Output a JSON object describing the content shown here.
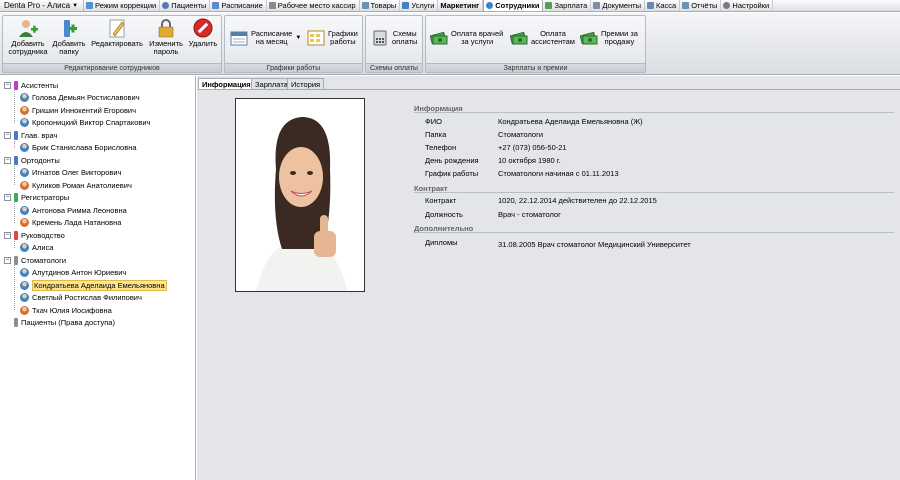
{
  "app_title": "Denta Pro - Алиса",
  "tabs": [
    {
      "label": "Режим коррекции",
      "icon": "mode-icon",
      "color": "#5a8fc9"
    },
    {
      "label": "Пациенты",
      "icon": "patients-icon",
      "color": "#4d79b5"
    },
    {
      "label": "Расписание",
      "icon": "schedule-icon",
      "color": "#5d8ccc"
    },
    {
      "label": "Рабочее место кассир",
      "icon": "cashier-icon",
      "color": "#8a8a8a"
    },
    {
      "label": "Товары",
      "icon": "goods-icon",
      "color": "#6e8fb0"
    },
    {
      "label": "Услуги",
      "icon": "services-icon",
      "color": "#4a7fc0"
    },
    {
      "label": "Маркетинг",
      "icon": "",
      "color": ""
    },
    {
      "label": "Сотрудники",
      "icon": "staff-icon",
      "color": "#3c83c8"
    },
    {
      "label": "Зарплата",
      "icon": "salary-icon",
      "color": "#5a9c5a"
    },
    {
      "label": "Документы",
      "icon": "documents-icon",
      "color": "#7d8ea5"
    },
    {
      "label": "Касса",
      "icon": "cash-icon",
      "color": "#6a8bb0"
    },
    {
      "label": "Отчёты",
      "icon": "reports-icon",
      "color": "#6f8fb5"
    },
    {
      "label": "Настройки",
      "icon": "settings-icon",
      "color": "#7a7a7a"
    }
  ],
  "ribbon": {
    "groups": {
      "staff": "Редактирование сотрудников",
      "schedules": "Графики работы",
      "payment_schemes": "Схемы оплаты",
      "salaries": "Зарплаты и премии"
    },
    "buttons": {
      "add_employee": [
        "Добавить",
        "сотрудника"
      ],
      "add_folder": [
        "Добавить",
        "папку"
      ],
      "edit": "Редактировать",
      "change_password": [
        "Изменить",
        "пароль"
      ],
      "delete": "Удалить",
      "monthly_schedule": [
        "Расписание",
        "на месяц"
      ],
      "work_schedules": [
        "Графики",
        "работы"
      ],
      "payment_schemes": [
        "Схемы",
        "оплаты"
      ],
      "doctor_pay": [
        "Оплата врачей",
        "за услуги"
      ],
      "assistant_pay": [
        "Оплата",
        "ассистентам"
      ],
      "sales_bonus": [
        "Премии за",
        "продажу"
      ]
    }
  },
  "tree": {
    "groups": [
      {
        "name": "Асистенты",
        "color": "#c23ad6",
        "members": [
          "Голова Демьян Ростиславович",
          "Гришин Иннокентий Егорович",
          "Кропоницкий Виктор Спартакович"
        ]
      },
      {
        "name": "Глав. врач",
        "color": "#4d79c9",
        "members": [
          "Брик Станислава Борисловна"
        ]
      },
      {
        "name": "Ортодонты",
        "color": "#4d79c9",
        "members": [
          "Игнатов Олег Викторович",
          "Куликов Роман Анатолиевич"
        ]
      },
      {
        "name": "Регистраторы",
        "color": "#3fae4a",
        "members": [
          "Антонова Римма Леоновна",
          "Кремень Лада Натановна"
        ]
      },
      {
        "name": "Руководство",
        "color": "#e0443a",
        "members": [
          "Алиса"
        ]
      },
      {
        "name": "Стоматологи",
        "color": "#8a8f98",
        "members": [
          "Алутдинов Антон Юриевич",
          "Кондратьева Аделаида Емельяновна",
          "Светлый Ростислав Филипович",
          "Ткач Юлия Иосифовна"
        ]
      }
    ],
    "extra": "Пациенты (Права доступа)",
    "selected": "Кондратьева Аделаида Емельяновна"
  },
  "detail_tabs": [
    "Информация",
    "Зарплата",
    "История"
  ],
  "info": {
    "sections": {
      "info": "Информация",
      "contract": "Контракт",
      "extra": "Дополнительно"
    },
    "fields": {
      "fio_label": "ФИО",
      "fio": "Кондратьева Аделаида Емельяновна (Ж)",
      "folder_label": "Папка",
      "folder": "Стоматологи",
      "phone_label": "Телефон",
      "phone": "+27 (073) 056-50-21",
      "birthday_label": "День рождения",
      "birthday": "10 октября 1980 г.",
      "schedule_label": "График работы",
      "schedule": "Стоматологи начиная с 01.11.2013",
      "contract_label": "Контракт",
      "contract": "1020, 22.12.2014 действителен до 22.12.2015",
      "position_label": "Должность",
      "position": "Врач - стоматолог",
      "diplomas_label": "Дипломы",
      "diplomas": "31.08.2005 Врач стоматолог Медицинский Университет"
    }
  },
  "colors": {
    "accent": "#3c83c8",
    "selection": "#fde48e",
    "panel": "#e3e5e9"
  }
}
